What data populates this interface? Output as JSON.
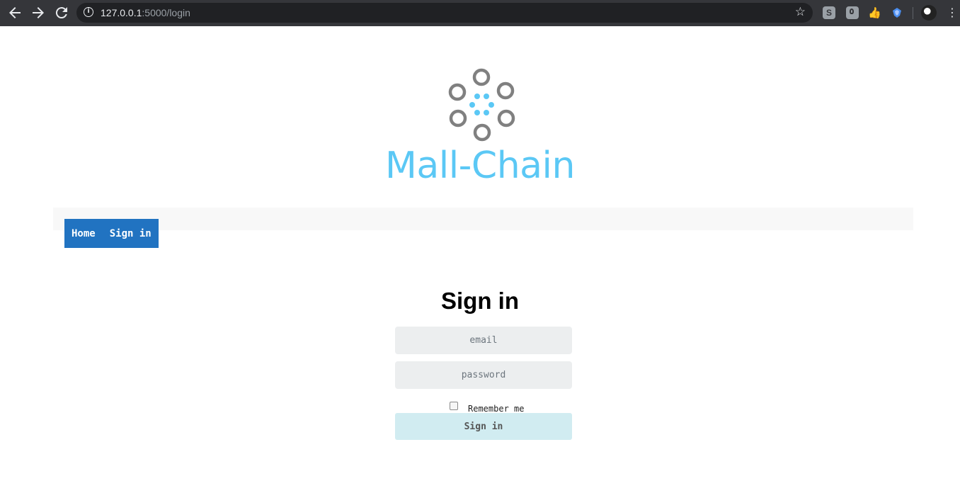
{
  "browser": {
    "url_host": "127.0.0.1",
    "url_path": ":5000/login",
    "back_icon": "arrow-left-icon",
    "forward_icon": "arrow-right-icon",
    "reload_icon": "reload-icon",
    "info_icon": "info-icon",
    "bookmark_icon": "star-icon",
    "extension_s_label": "S",
    "menu_icon": "kebab-menu-icon"
  },
  "brand": {
    "name": "Mall-Chain",
    "color": "#5bc8f5",
    "ring_color": "#808080"
  },
  "nav": {
    "items": [
      {
        "label": "Home"
      },
      {
        "label": "Sign in"
      }
    ],
    "color": "#2173c1"
  },
  "form": {
    "title": "Sign in",
    "email_placeholder": "email",
    "password_placeholder": "password",
    "remember_label": "Remember me",
    "remember_checked": false,
    "submit_label": "Sign in"
  }
}
